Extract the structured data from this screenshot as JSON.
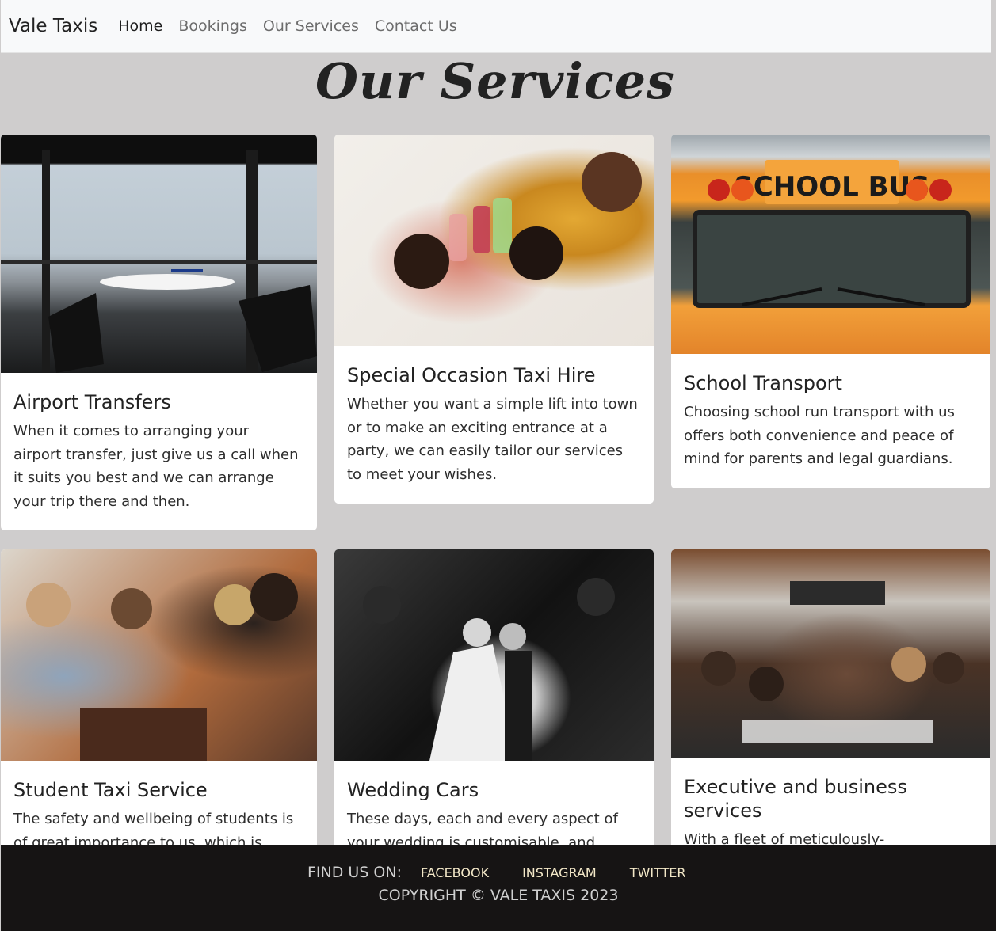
{
  "nav": {
    "brand": "Vale Taxis",
    "links": [
      "Home",
      "Bookings",
      "Our Services",
      "Contact Us"
    ]
  },
  "page": {
    "title": "Our Services"
  },
  "services": [
    {
      "title": "Airport Transfers",
      "text": "When it comes to arranging your airport transfer, just give us a call when it suits you best and we can arrange your trip there and then.",
      "image": "airport-lounge-photo"
    },
    {
      "title": "Special Occasion Taxi Hire",
      "text": "Whether you want a simple lift into town or to make an exciting entrance at a party, we can easily tailor our services to meet your wishes.",
      "image": "friends-toasting-photo"
    },
    {
      "title": "School Transport",
      "text": "Choosing school run transport with us offers both convenience and peace of mind for parents and legal guardians.",
      "image": "school-bus-photo",
      "image_text": "SCHOOL BUS"
    },
    {
      "title": "Student Taxi Service",
      "text": "The safety and wellbeing of students is of great importance to us, which is",
      "image": "students-cafe-photo"
    },
    {
      "title": "Wedding Cars",
      "text": "These days, each and every aspect of your wedding is customisable, and",
      "image": "wedding-couple-photo"
    },
    {
      "title": "Executive and business services",
      "text": "With a fleet of meticulously-",
      "image": "business-meeting-photo"
    }
  ],
  "footer": {
    "find_label": "FIND US ON:",
    "social": [
      "FACEBOOK",
      "INSTAGRAM",
      "TWITTER"
    ],
    "copyright": "COPYRIGHT © VALE TAXIS 2023"
  }
}
